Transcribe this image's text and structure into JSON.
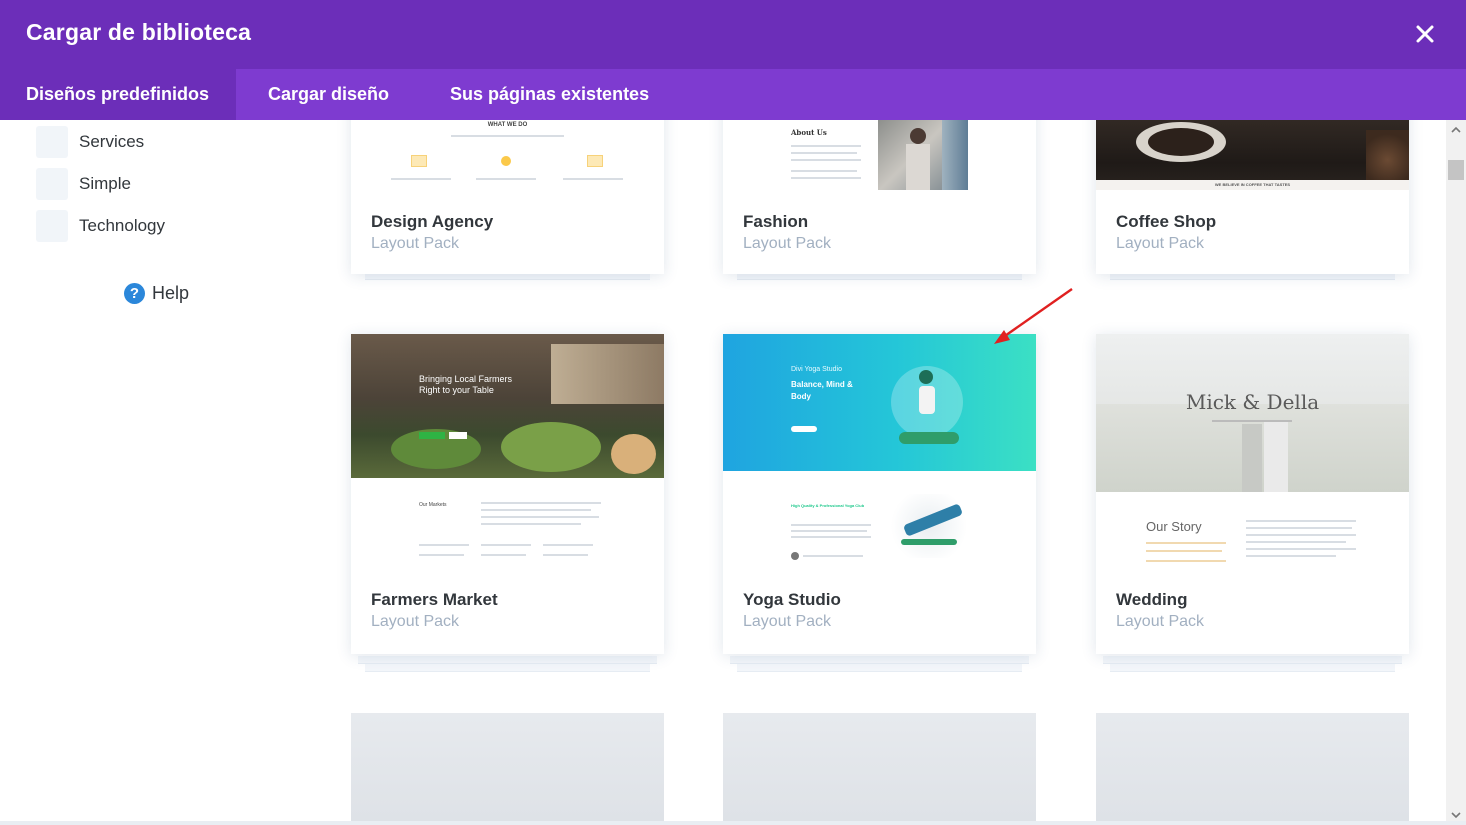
{
  "modal": {
    "title": "Cargar de biblioteca",
    "close_icon": "close-icon"
  },
  "tabs": [
    {
      "label": "Diseños predefinidos",
      "active": true
    },
    {
      "label": "Cargar diseño",
      "active": false
    },
    {
      "label": "Sus páginas existentes",
      "active": false
    }
  ],
  "sidebar": {
    "categories": [
      {
        "label": "Services"
      },
      {
        "label": "Simple"
      },
      {
        "label": "Technology"
      }
    ],
    "help_label": "Help",
    "help_icon": "question-circle-icon"
  },
  "layouts": [
    {
      "name": "Design Agency",
      "pack": "Layout Pack",
      "thumb_heading": "WHAT WE DO"
    },
    {
      "name": "Fashion",
      "pack": "Layout Pack",
      "thumb_heading": "About Us"
    },
    {
      "name": "Coffee Shop",
      "pack": "Layout Pack",
      "thumb_caption": "WE BELIEVE IN COFFEE THAT TASTES"
    },
    {
      "name": "Farmers Market",
      "pack": "Layout Pack",
      "thumb_headline": "Bringing Local Farmers Right to your Table",
      "thumb_section": "Our Markets"
    },
    {
      "name": "Yoga Studio",
      "pack": "Layout Pack",
      "thumb_kicker": "Divi Yoga Studio",
      "thumb_headline": "Balance, Mind & Body",
      "thumb_section": "High Quality & Professional Yoga Club"
    },
    {
      "name": "Wedding",
      "pack": "Layout Pack",
      "thumb_headline": "Mick & Della",
      "thumb_section": "Our Story"
    }
  ],
  "colors": {
    "header_bg": "#6c2eb9",
    "tabbar_bg": "#7e3bd0",
    "active_tab_bg": "#6c2eb9",
    "help_icon": "#2b87da",
    "pack_text": "#a2b0c1",
    "annotation_arrow": "#e02020"
  }
}
